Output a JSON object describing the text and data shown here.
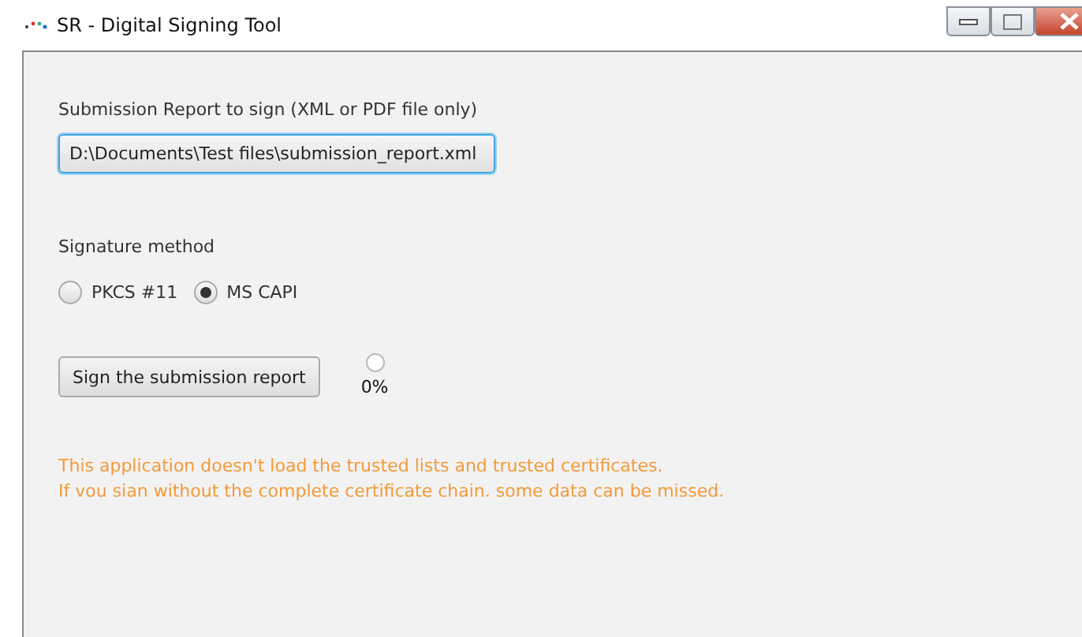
{
  "window": {
    "title": "SR - Digital Signing Tool"
  },
  "file": {
    "label": "Submission Report to sign (XML or PDF file only)",
    "value": "D:\\Documents\\Test files\\submission_report.xml"
  },
  "signature": {
    "label": "Signature method",
    "options": [
      {
        "label": "PKCS #11",
        "selected": false
      },
      {
        "label": "MS CAPI",
        "selected": true
      }
    ]
  },
  "sign_button": "Sign the submission report",
  "progress": {
    "reading": "0%"
  },
  "warnings": [
    "This application doesn't load the trusted lists and trusted certificates.",
    "If vou sian without the complete certificate chain. some data can be missed."
  ]
}
